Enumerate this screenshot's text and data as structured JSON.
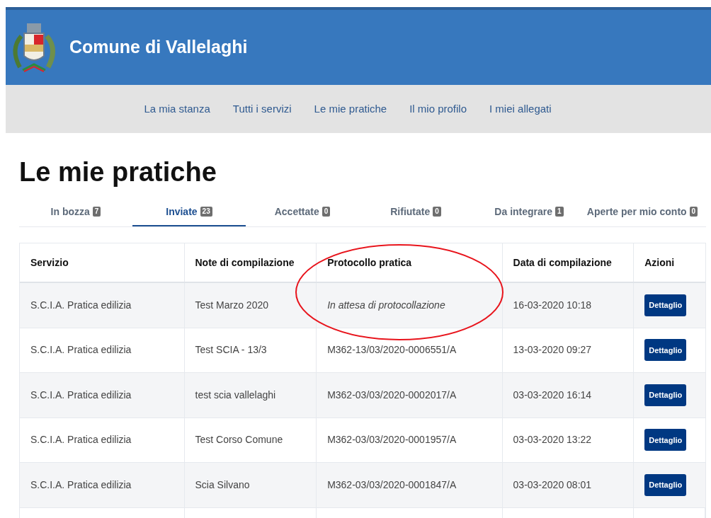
{
  "header": {
    "title": "Comune di Vallelaghi"
  },
  "nav": [
    {
      "label": "La mia stanza"
    },
    {
      "label": "Tutti i servizi"
    },
    {
      "label": "Le mie pratiche"
    },
    {
      "label": "Il mio profilo"
    },
    {
      "label": "I miei allegati"
    }
  ],
  "page_title": "Le mie pratiche",
  "tabs": [
    {
      "label": "In bozza",
      "count": "7",
      "selected": false
    },
    {
      "label": "Inviate",
      "count": "23",
      "selected": true
    },
    {
      "label": "Accettate",
      "count": "0",
      "selected": false
    },
    {
      "label": "Rifiutate",
      "count": "0",
      "selected": false
    },
    {
      "label": "Da integrare",
      "count": "1",
      "selected": false
    },
    {
      "label": "Aperte per mio conto",
      "count": "0",
      "selected": false
    }
  ],
  "table": {
    "columns": [
      "Servizio",
      "Note di compilazione",
      "Protocollo pratica",
      "Data di compilazione",
      "Azioni"
    ],
    "rows": [
      {
        "servizio": "S.C.I.A. Pratica edilizia",
        "note": "Test Marzo 2020",
        "protocollo": "In attesa di protocollazione",
        "pending": true,
        "circled": true,
        "data": "16-03-2020 10:18",
        "action": "Dettaglio"
      },
      {
        "servizio": "S.C.I.A. Pratica edilizia",
        "note": "Test SCIA - 13/3",
        "protocollo": "M362-13/03/2020-0006551/A",
        "pending": false,
        "circled": false,
        "data": "13-03-2020 09:27",
        "action": "Dettaglio"
      },
      {
        "servizio": "S.C.I.A. Pratica edilizia",
        "note": "test scia vallelaghi",
        "protocollo": "M362-03/03/2020-0002017/A",
        "pending": false,
        "circled": false,
        "data": "03-03-2020 16:14",
        "action": "Dettaglio"
      },
      {
        "servizio": "S.C.I.A. Pratica edilizia",
        "note": "Test Corso Comune",
        "protocollo": "M362-03/03/2020-0001957/A",
        "pending": false,
        "circled": false,
        "data": "03-03-2020 13:22",
        "action": "Dettaglio"
      },
      {
        "servizio": "S.C.I.A. Pratica edilizia",
        "note": "Scia Silvano",
        "protocollo": "M362-03/03/2020-0001847/A",
        "pending": false,
        "circled": false,
        "data": "03-03-2020 08:01",
        "action": "Dettaglio"
      }
    ]
  }
}
